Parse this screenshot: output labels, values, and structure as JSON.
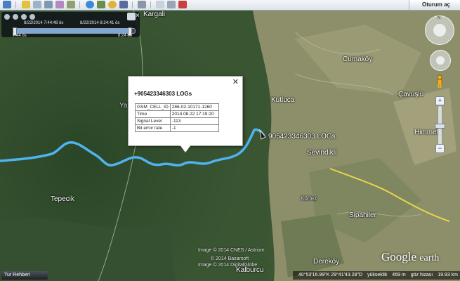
{
  "toolbar": {
    "signin_label": "Oturum aç"
  },
  "time_slider": {
    "range_left": "8/22/2014 7:44:48 ös",
    "range_right": "8/22/2014 8:24:41 ös",
    "start_time": "7:44 ös",
    "end_time": "8:24 ös",
    "position_fraction": 0.96
  },
  "popup": {
    "title": "+905423346303 LOGs",
    "close_glyph": "✕",
    "rows": [
      {
        "key": "GSM_CELL_ID",
        "value": "286-02-10171-1260"
      },
      {
        "key": "Time",
        "value": "2014.08.22 17:19:20"
      },
      {
        "key": "Signal Level",
        "value": "-113"
      },
      {
        "key": "Bit error rate",
        "value": "-1"
      }
    ]
  },
  "map": {
    "track_label": "905423346303 LOGs",
    "places": {
      "kargali": "Kargali",
      "ya": "Ya",
      "cumakoy": "Cumaköy",
      "kutluca": "Kutluca",
      "cavuslu": "Çavuşlu",
      "himmetli": "Himmetli",
      "sevindikli": "Sevindikli",
      "korfez": "Körfez",
      "tepecik": "Tepecik",
      "sipahiler": "Sipahiler",
      "derekoy": "Dereköy",
      "kalburcu": "Kalburcu"
    },
    "credits": [
      "Image © 2014 DigitalGlobe",
      "© 2014 Basarsoft",
      "Image © 2014 CNES / Astrium"
    ],
    "track_color": "#4fb3f0",
    "road_color": "#e8d44d"
  },
  "nav": {
    "north_label": "N",
    "zoom_in": "+",
    "zoom_out": "−",
    "zoom_fraction": 0.45
  },
  "tour_label": "Tur Rehberi",
  "status": {
    "coords": "40°53'16.99\"K  29°41'43.28\"D",
    "elevation_label": "yükseklik",
    "elevation": "469 m",
    "eye_label": "göz hizası",
    "eye_altitude": "19.93 km"
  },
  "logo": {
    "google": "Google",
    "earth": "earth"
  }
}
